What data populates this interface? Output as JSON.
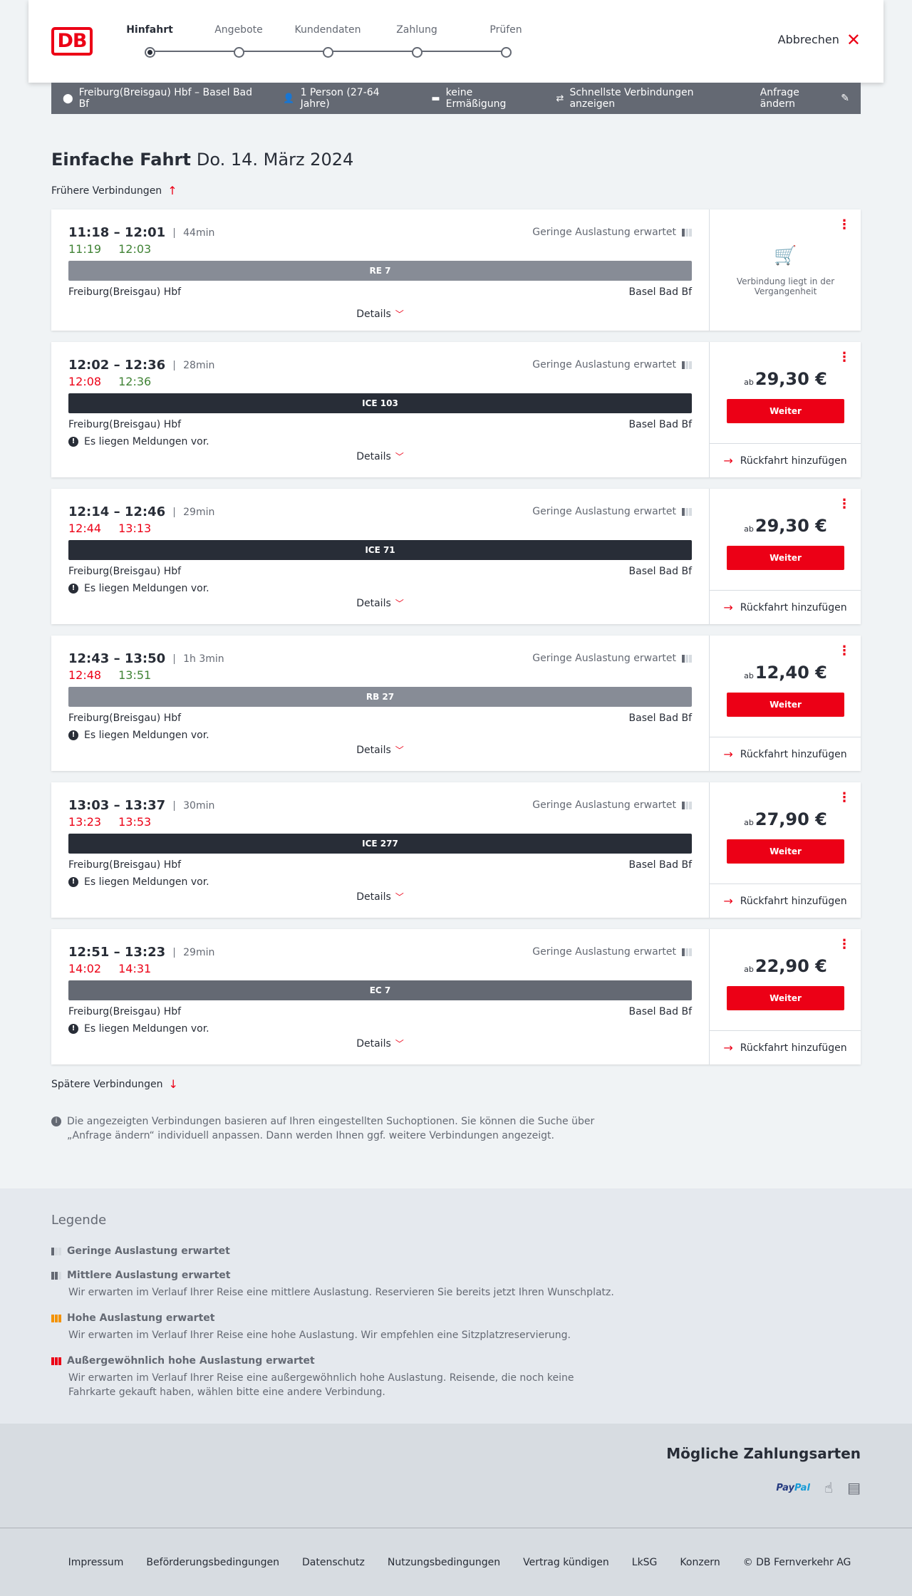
{
  "header": {
    "logo": "DB",
    "steps": [
      "Hinfahrt",
      "Angebote",
      "Kundendaten",
      "Zahlung",
      "Prüfen"
    ],
    "active_step": 0,
    "cancel_label": "Abbrechen"
  },
  "summary": {
    "route": "Freiburg(Breisgau) Hbf – Basel Bad Bf",
    "travellers": "1 Person (27-64 Jahre)",
    "discount": "keine Ermäßigung",
    "fastest": "Schnellste Verbindungen anzeigen",
    "edit_label": "Anfrage ändern"
  },
  "page": {
    "title_type": "Einfache Fahrt",
    "title_date": "Do. 14. März 2024",
    "earlier_label": "Frühere Verbindungen",
    "later_label": "Spätere Verbindungen",
    "info_text": "Die angezeigten Verbindungen basieren auf Ihren eingestellten Suchoptionen. Sie können die Suche über „Anfrage ändern“ individuell anpassen. Dann werden Ihnen ggf. weitere Verbindungen angezeigt.",
    "load_text": "Geringe Auslastung erwartet",
    "from": "Freiburg(Breisgau) Hbf",
    "to": "Basel Bad Bf",
    "message_text": "Es liegen Meldungen vor.",
    "details_label": "Details",
    "price_prefix": "ab",
    "continue_label": "Weiter",
    "return_label": "Rückfahrt hinzufügen",
    "past_text": "Verbindung liegt in der Vergangenheit"
  },
  "connections": [
    {
      "times": "11:18 – 12:01",
      "duration": "44min",
      "rt_dep": "11:19",
      "rt_arr": "12:03",
      "rt_dep_status": "ok",
      "rt_arr_status": "ok",
      "train": "RE 7",
      "train_color": "#878c96",
      "message": false,
      "price": null,
      "past": true
    },
    {
      "times": "12:02 – 12:36",
      "duration": "28min",
      "rt_dep": "12:08",
      "rt_arr": "12:36",
      "rt_dep_status": "late",
      "rt_arr_status": "ok",
      "train": "ICE 103",
      "train_color": "#282d37",
      "message": true,
      "price": "29,30 €",
      "past": false
    },
    {
      "times": "12:14 – 12:46",
      "duration": "29min",
      "rt_dep": "12:44",
      "rt_arr": "13:13",
      "rt_dep_status": "late",
      "rt_arr_status": "late",
      "train": "ICE 71",
      "train_color": "#282d37",
      "message": true,
      "price": "29,30 €",
      "past": false
    },
    {
      "times": "12:43 – 13:50",
      "duration": "1h 3min",
      "rt_dep": "12:48",
      "rt_arr": "13:51",
      "rt_dep_status": "late",
      "rt_arr_status": "ok",
      "train": "RB 27",
      "train_color": "#878c96",
      "message": true,
      "price": "12,40 €",
      "past": false
    },
    {
      "times": "13:03 – 13:37",
      "duration": "30min",
      "rt_dep": "13:23",
      "rt_arr": "13:53",
      "rt_dep_status": "late",
      "rt_arr_status": "late",
      "train": "ICE 277",
      "train_color": "#282d37",
      "message": true,
      "price": "27,90 €",
      "past": false
    },
    {
      "times": "12:51 – 13:23",
      "duration": "29min",
      "rt_dep": "14:02",
      "rt_arr": "14:31",
      "rt_dep_status": "late",
      "rt_arr_status": "late",
      "train": "EC 7",
      "train_color": "#646973",
      "message": true,
      "price": "22,90 €",
      "past": false
    }
  ],
  "legend": {
    "title": "Legende",
    "items": [
      {
        "title": "Geringe Auslastung erwartet",
        "desc": "",
        "color": "#646973"
      },
      {
        "title": "Mittlere Auslastung erwartet",
        "desc": "Wir erwarten im Verlauf Ihrer Reise eine mittlere Auslastung. Reservieren Sie bereits jetzt Ihren Wunschplatz.",
        "color": "#646973"
      },
      {
        "title": "Hohe Auslastung erwartet",
        "desc": "Wir erwarten im Verlauf Ihrer Reise eine hohe Auslastung. Wir empfehlen eine Sitzplatzreservierung.",
        "color": "#f39200"
      },
      {
        "title": "Außergewöhnlich hohe Auslastung erwartet",
        "desc": "Wir erwarten im Verlauf Ihrer Reise eine außergewöhnlich hohe Auslastung. Reisende, die noch keine Fahrkarte gekauft haben, wählen bitte eine andere Verbindung.",
        "color": "#ec0016"
      }
    ]
  },
  "payment": {
    "title": "Mögliche Zahlungsarten",
    "paypal_a": "Pay",
    "paypal_b": "Pal"
  },
  "footer": {
    "links": [
      "Impressum",
      "Beförderungsbedingungen",
      "Datenschutz",
      "Nutzungsbedingungen",
      "Vertrag kündigen",
      "LkSG",
      "Konzern",
      "© DB Fernverkehr AG"
    ]
  },
  "colors": {
    "brand": "#ec0016",
    "ok": "#408335",
    "late": "#ec0016"
  }
}
